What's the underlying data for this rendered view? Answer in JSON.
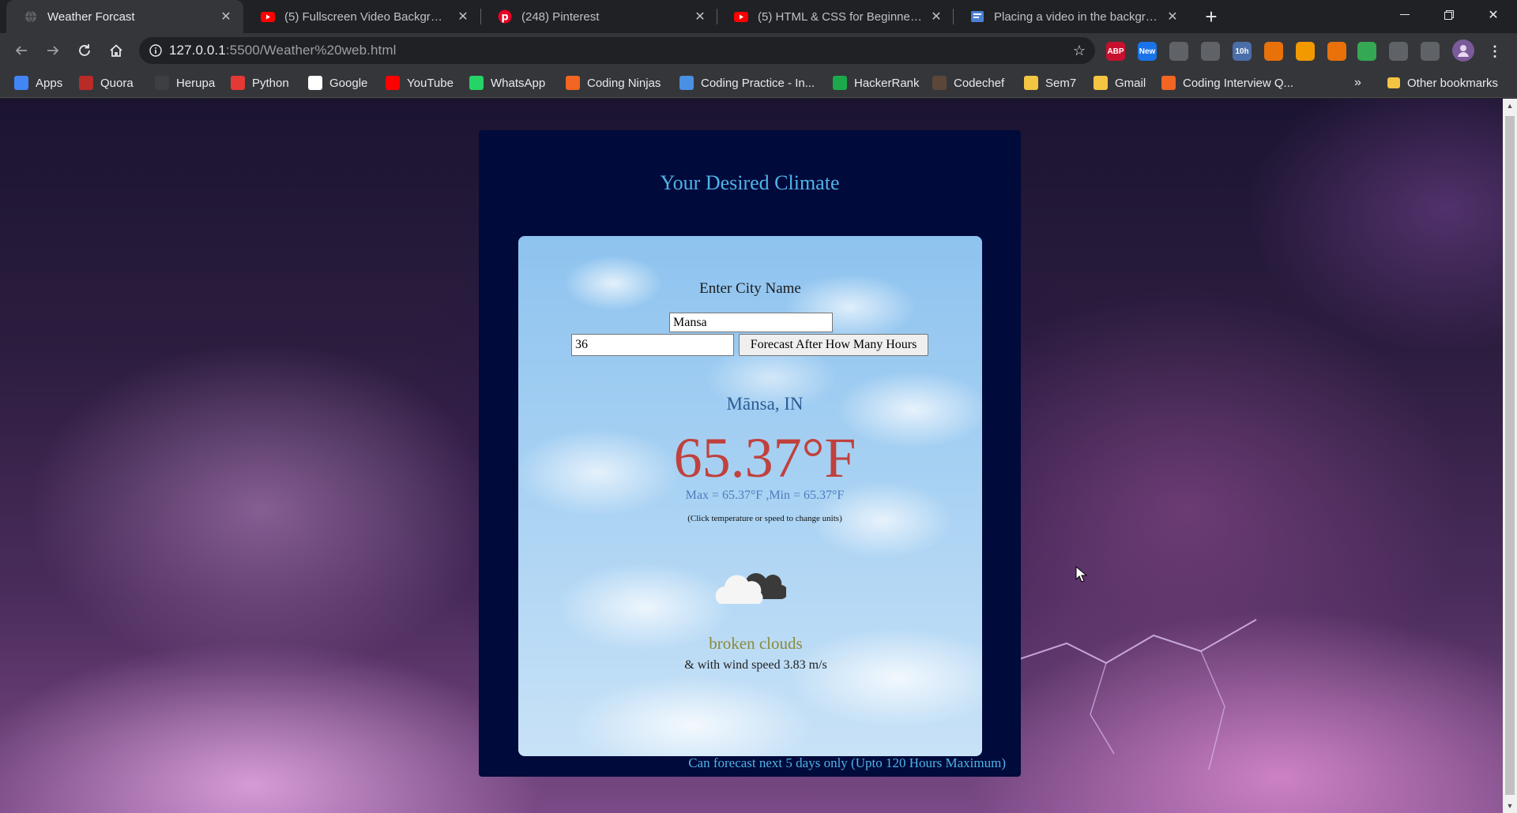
{
  "browser": {
    "tabs": [
      {
        "title": "Weather Forcast",
        "icon": "globe-icon",
        "active": true
      },
      {
        "title": "(5) Fullscreen Video Background",
        "icon": "youtube-icon",
        "active": false
      },
      {
        "title": "(248) Pinterest",
        "icon": "pinterest-icon",
        "active": false
      },
      {
        "title": "(5) HTML & CSS for Beginners Pa",
        "icon": "youtube-icon",
        "active": false
      },
      {
        "title": "Placing a video in the backgroun",
        "icon": "document-icon",
        "active": false
      }
    ],
    "url_host": "127.0.0.1",
    "url_path": ":5500/Weather%20web.html",
    "extensions": [
      {
        "name": "adblock-icon",
        "text": "ABP",
        "color": "#c8102e"
      },
      {
        "name": "new-extension-icon",
        "text": "New",
        "color": "#1a73e8"
      },
      {
        "name": "cast-extension-icon",
        "text": "",
        "color": "#5f6368"
      },
      {
        "name": "cloud-extension-icon",
        "text": "",
        "color": "#5f6368"
      },
      {
        "name": "timer-extension-icon",
        "text": "10h",
        "color": "#4a6ea9"
      },
      {
        "name": "orange-extension-icon",
        "text": "",
        "color": "#e8710a"
      },
      {
        "name": "small-orange-extension-icon",
        "text": "",
        "color": "#f29900"
      },
      {
        "name": "flag-extension-icon",
        "text": "",
        "color": "#e8710a"
      },
      {
        "name": "green-check-extension-icon",
        "text": "",
        "color": "#34a853"
      },
      {
        "name": "puzzle-icon",
        "text": "",
        "color": "#5f6368"
      },
      {
        "name": "media-icon",
        "text": "",
        "color": "#5f6368"
      }
    ],
    "bookmarks": [
      {
        "label": "Apps",
        "icon": "apps-icon",
        "color": "#4285f4"
      },
      {
        "label": "Quora",
        "icon": "quora-icon",
        "color": "#b92b27"
      },
      {
        "label": "Herupa",
        "icon": "herupa-icon",
        "color": "#3c4043"
      },
      {
        "label": "Python",
        "icon": "python-icon",
        "color": "#e53935"
      },
      {
        "label": "Google",
        "icon": "google-icon",
        "color": "#ffffff"
      },
      {
        "label": "YouTube",
        "icon": "youtube-icon",
        "color": "#ff0000"
      },
      {
        "label": "WhatsApp",
        "icon": "whatsapp-icon",
        "color": "#25d366"
      },
      {
        "label": "Coding Ninjas",
        "icon": "coding-ninjas-icon",
        "color": "#f26522"
      },
      {
        "label": "Coding Practice - In...",
        "icon": "interviewbit-icon",
        "color": "#4a90e2"
      },
      {
        "label": "HackerRank",
        "icon": "hackerrank-icon",
        "color": "#1ba94c"
      },
      {
        "label": "Codechef",
        "icon": "codechef-icon",
        "color": "#5b4638"
      },
      {
        "label": "Sem7",
        "icon": "folder-icon",
        "color": "#f4c542"
      },
      {
        "label": "Gmail",
        "icon": "folder-icon",
        "color": "#f4c542"
      },
      {
        "label": "Coding Interview Q...",
        "icon": "coding-ninjas-icon",
        "color": "#f26522"
      }
    ],
    "more_bookmarks": "»",
    "other_bookmarks": "Other bookmarks"
  },
  "page": {
    "heading": "Your Desired Climate",
    "city_label": "Enter City Name",
    "city_value": "Mansa",
    "hours_value": "36",
    "forecast_button": "Forecast After How Many Hours",
    "location": "Mānsa, IN",
    "temperature": "65.37°F",
    "minmax": "Max = 65.37°F ,Min = 65.37°F",
    "units_hint": "(Click temperature or speed to change units)",
    "weather_icon": "broken-clouds-icon",
    "description": "broken clouds",
    "wind_text": "& with wind speed 3.83 m/s",
    "footer_note": "Can forecast next 5 days only (Upto 120 Hours Maximum)"
  }
}
